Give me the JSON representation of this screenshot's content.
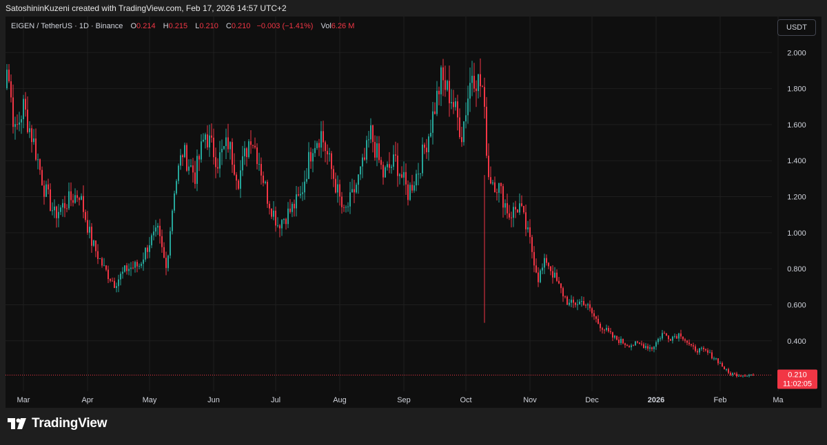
{
  "header": {
    "attribution": "SatoshininKuzeni created with TradingView.com, Feb 17, 2026 14:57 UTC+2"
  },
  "legend": {
    "symbol": "EIGEN / TetherUS · 1D · Binance",
    "open_label": "O",
    "open": "0.214",
    "high_label": "H",
    "high": "0.215",
    "low_label": "L",
    "low": "0.210",
    "close_label": "C",
    "close": "0.210",
    "change": "−0.003 (−1.41%)",
    "vol_label": "Vol",
    "vol": "6.26 M"
  },
  "currency_button": "USDT",
  "price_label": {
    "price": "0.210",
    "countdown": "11:02:05"
  },
  "footer": {
    "brand": "TradingView",
    "logo_icon": "tradingview-logo-icon"
  },
  "colors": {
    "up": "#26a69a",
    "down": "#f23645",
    "background": "#0f0f0f",
    "grid": "#1f1f1f",
    "text": "#d1d4dc"
  },
  "chart_data": {
    "type": "candlestick",
    "ylim": [
      0.12,
      2.2
    ],
    "y_ticks": [
      "2.000",
      "1.800",
      "1.600",
      "1.400",
      "1.200",
      "1.000",
      "0.800",
      "0.600",
      "0.400"
    ],
    "y_tick_values": [
      2.0,
      1.8,
      1.6,
      1.4,
      1.2,
      1.0,
      0.8,
      0.6,
      0.4
    ],
    "x_ticks": [
      {
        "label": "Mar",
        "month": 1
      },
      {
        "label": "Apr",
        "month": 2
      },
      {
        "label": "May",
        "month": 3
      },
      {
        "label": "Jun",
        "month": 4
      },
      {
        "label": "Jul",
        "month": 5
      },
      {
        "label": "Aug",
        "month": 6
      },
      {
        "label": "Sep",
        "month": 7
      },
      {
        "label": "Oct",
        "month": 8
      },
      {
        "label": "Nov",
        "month": 9
      },
      {
        "label": "Dec",
        "month": 10
      },
      {
        "label": "2026",
        "month": 11,
        "bold": true
      },
      {
        "label": "Feb",
        "month": 12
      },
      {
        "label": "Ma",
        "month": 13
      }
    ],
    "current_price": 0.21,
    "close_path": [
      {
        "date": "2025-02-18",
        "close": 1.7
      },
      {
        "date": "2025-02-21",
        "close": 1.95
      },
      {
        "date": "2025-02-25",
        "close": 1.55
      },
      {
        "date": "2025-03-01",
        "close": 1.7
      },
      {
        "date": "2025-03-06",
        "close": 1.5
      },
      {
        "date": "2025-03-11",
        "close": 1.25
      },
      {
        "date": "2025-03-16",
        "close": 1.1
      },
      {
        "date": "2025-03-22",
        "close": 1.17
      },
      {
        "date": "2025-03-28",
        "close": 1.22
      },
      {
        "date": "2025-04-03",
        "close": 0.95
      },
      {
        "date": "2025-04-09",
        "close": 0.8
      },
      {
        "date": "2025-04-14",
        "close": 0.72
      },
      {
        "date": "2025-04-20",
        "close": 0.8
      },
      {
        "date": "2025-04-26",
        "close": 0.82
      },
      {
        "date": "2025-05-01",
        "close": 0.95
      },
      {
        "date": "2025-05-05",
        "close": 1.0
      },
      {
        "date": "2025-05-09",
        "close": 0.8
      },
      {
        "date": "2025-05-13",
        "close": 1.25
      },
      {
        "date": "2025-05-17",
        "close": 1.45
      },
      {
        "date": "2025-05-23",
        "close": 1.32
      },
      {
        "date": "2025-05-28",
        "close": 1.55
      },
      {
        "date": "2025-06-03",
        "close": 1.4
      },
      {
        "date": "2025-06-08",
        "close": 1.5
      },
      {
        "date": "2025-06-13",
        "close": 1.3
      },
      {
        "date": "2025-06-19",
        "close": 1.55
      },
      {
        "date": "2025-06-23",
        "close": 1.4
      },
      {
        "date": "2025-06-27",
        "close": 1.2
      },
      {
        "date": "2025-07-02",
        "close": 1.05
      },
      {
        "date": "2025-07-08",
        "close": 1.12
      },
      {
        "date": "2025-07-13",
        "close": 1.2
      },
      {
        "date": "2025-07-19",
        "close": 1.5
      },
      {
        "date": "2025-07-23",
        "close": 1.55
      },
      {
        "date": "2025-07-28",
        "close": 1.35
      },
      {
        "date": "2025-08-03",
        "close": 1.1
      },
      {
        "date": "2025-08-07",
        "close": 1.2
      },
      {
        "date": "2025-08-13",
        "close": 1.4
      },
      {
        "date": "2025-08-16",
        "close": 1.55
      },
      {
        "date": "2025-08-22",
        "close": 1.32
      },
      {
        "date": "2025-08-28",
        "close": 1.4
      },
      {
        "date": "2025-09-03",
        "close": 1.22
      },
      {
        "date": "2025-09-08",
        "close": 1.35
      },
      {
        "date": "2025-09-13",
        "close": 1.55
      },
      {
        "date": "2025-09-19",
        "close": 1.85
      },
      {
        "date": "2025-09-24",
        "close": 1.75
      },
      {
        "date": "2025-09-29",
        "close": 1.55
      },
      {
        "date": "2025-10-04",
        "close": 1.9
      },
      {
        "date": "2025-10-09",
        "close": 1.8
      },
      {
        "date": "2025-10-12",
        "close": 1.32
      },
      {
        "date": "2025-10-17",
        "close": 1.25
      },
      {
        "date": "2025-10-22",
        "close": 1.1
      },
      {
        "date": "2025-10-27",
        "close": 1.15
      },
      {
        "date": "2025-11-01",
        "close": 0.95
      },
      {
        "date": "2025-11-05",
        "close": 0.75
      },
      {
        "date": "2025-11-09",
        "close": 0.85
      },
      {
        "date": "2025-11-15",
        "close": 0.7
      },
      {
        "date": "2025-11-20",
        "close": 0.6
      },
      {
        "date": "2025-11-27",
        "close": 0.62
      },
      {
        "date": "2025-12-04",
        "close": 0.5
      },
      {
        "date": "2025-12-11",
        "close": 0.42
      },
      {
        "date": "2025-12-18",
        "close": 0.38
      },
      {
        "date": "2025-12-25",
        "close": 0.38
      },
      {
        "date": "2025-12-30",
        "close": 0.36
      },
      {
        "date": "2026-01-04",
        "close": 0.44
      },
      {
        "date": "2026-01-08",
        "close": 0.42
      },
      {
        "date": "2026-01-13",
        "close": 0.44
      },
      {
        "date": "2026-01-18",
        "close": 0.36
      },
      {
        "date": "2026-01-25",
        "close": 0.34
      },
      {
        "date": "2026-01-30",
        "close": 0.3
      },
      {
        "date": "2026-02-05",
        "close": 0.22
      },
      {
        "date": "2026-02-10",
        "close": 0.21
      },
      {
        "date": "2026-02-17",
        "close": 0.21
      }
    ]
  }
}
